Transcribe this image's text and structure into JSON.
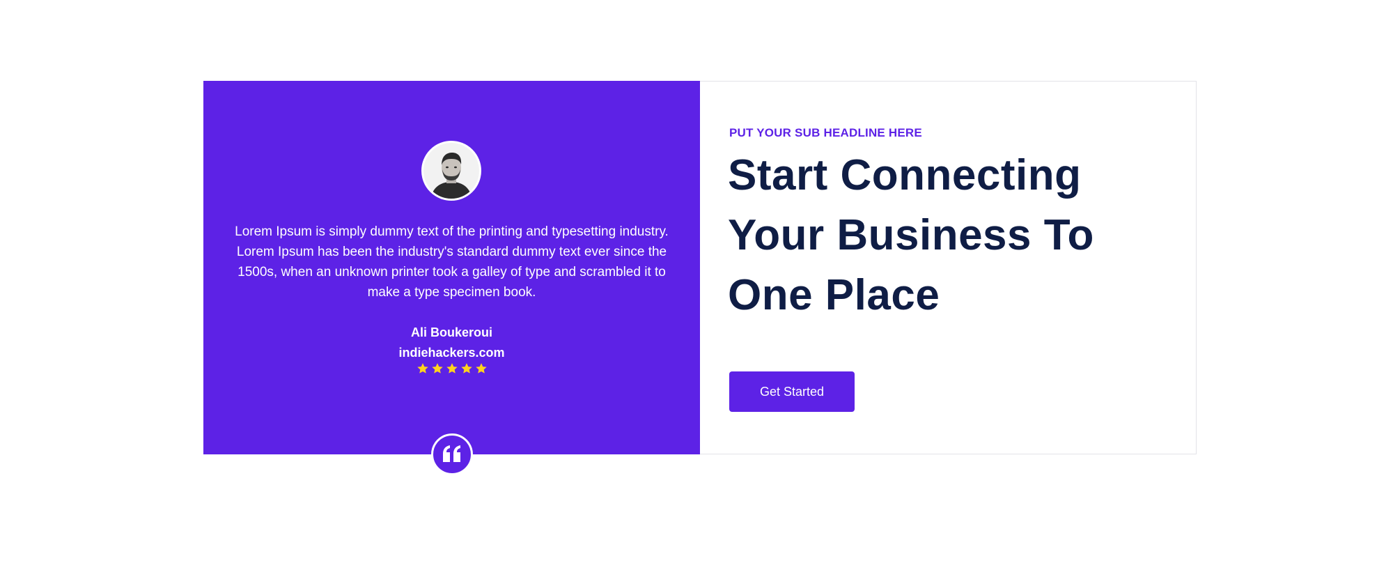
{
  "testimonial": {
    "avatar_alt": "avatar",
    "quote": "Lorem Ipsum is simply dummy text of the printing and typesetting industry. Lorem Ipsum has been the industry's standard dummy text ever since the 1500s, when an unknown printer took a galley of type and scrambled it to make a type specimen book.",
    "author_name": "Ali Boukeroui",
    "author_site": "indiehackers.com",
    "rating": 5,
    "rating_max": 5,
    "quote_icon": "quote-icon"
  },
  "hero": {
    "sub_headline": "PUT YOUR SUB HEADLINE HERE",
    "headline": "Start Connecting Your Business To One Place",
    "cta_label": "Get Started"
  },
  "colors": {
    "brand_purple": "#5d22e6",
    "headline_navy": "#0f1d45",
    "star_yellow": "#ffd21f",
    "card_border": "#e3e3e8"
  }
}
